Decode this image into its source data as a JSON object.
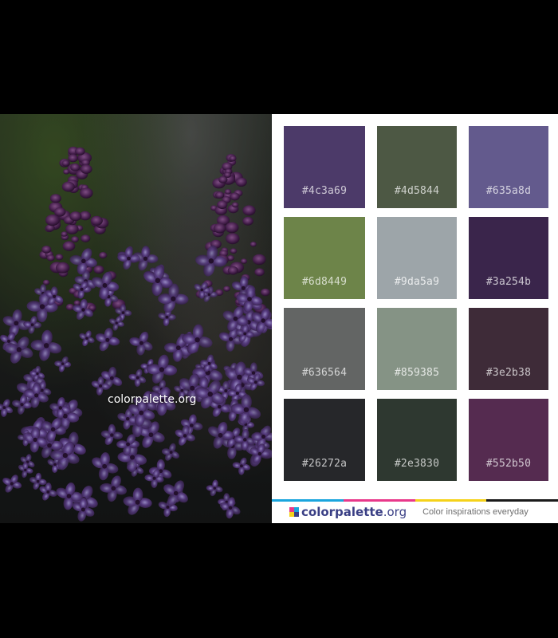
{
  "photo": {
    "watermark": "colorpalette.org"
  },
  "palette": {
    "swatches": [
      {
        "hex": "#4c3a69",
        "label": "#4c3a69"
      },
      {
        "hex": "#4d5844",
        "label": "#4d5844"
      },
      {
        "hex": "#635a8d",
        "label": "#635a8d"
      },
      {
        "hex": "#6d8449",
        "label": "#6d8449"
      },
      {
        "hex": "#9da5a9",
        "label": "#9da5a9"
      },
      {
        "hex": "#3a254b",
        "label": "#3a254b"
      },
      {
        "hex": "#636564",
        "label": "#636564"
      },
      {
        "hex": "#859385",
        "label": "#859385"
      },
      {
        "hex": "#3e2b38",
        "label": "#3e2b38"
      },
      {
        "hex": "#26272a",
        "label": "#26272a"
      },
      {
        "hex": "#2e3830",
        "label": "#2e3830"
      },
      {
        "hex": "#552b50",
        "label": "#552b50"
      }
    ]
  },
  "footer": {
    "brand_main": "colorpalette",
    "brand_tld": ".org",
    "tagline": "Color inspirations everyday",
    "logo_colors": [
      "#e8388a",
      "#1aa5dd",
      "#f5d21a",
      "#3a3f85"
    ],
    "stripe_colors": [
      "#1aa5dd",
      "#e8388a",
      "#f5d21a",
      "#1a1a1a"
    ]
  }
}
